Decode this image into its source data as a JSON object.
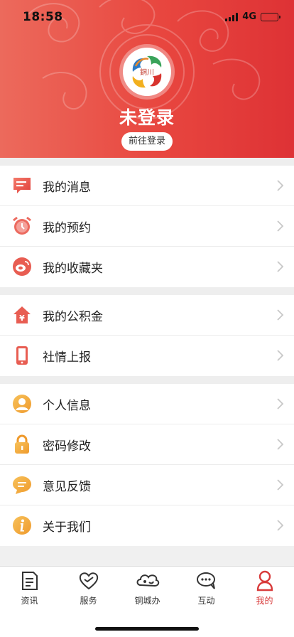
{
  "status_bar": {
    "time": "18:58",
    "network": "4G"
  },
  "profile": {
    "name": "未登录",
    "login_button": "前往登录",
    "logo_text": "銅川"
  },
  "menu_groups": [
    {
      "items": [
        {
          "label": "我的消息",
          "icon": "message-icon"
        },
        {
          "label": "我的预约",
          "icon": "alarm-clock-icon"
        },
        {
          "label": "我的收藏夹",
          "icon": "weibo-icon"
        }
      ]
    },
    {
      "items": [
        {
          "label": "我的公积金",
          "icon": "housing-fund-icon"
        },
        {
          "label": "社情上报",
          "icon": "phone-icon"
        }
      ]
    },
    {
      "items": [
        {
          "label": "个人信息",
          "icon": "user-icon"
        },
        {
          "label": "密码修改",
          "icon": "lock-icon"
        },
        {
          "label": "意见反馈",
          "icon": "feedback-icon"
        },
        {
          "label": "关于我们",
          "icon": "info-icon"
        }
      ]
    }
  ],
  "tabbar": {
    "items": [
      {
        "label": "资讯",
        "icon": "news-icon"
      },
      {
        "label": "服务",
        "icon": "heart-icon"
      },
      {
        "label": "铜城办",
        "icon": "cloud-icon"
      },
      {
        "label": "互动",
        "icon": "chat-icon"
      },
      {
        "label": "我的",
        "icon": "profile-icon",
        "active": true
      }
    ]
  },
  "colors": {
    "brand_red": "#e8463f",
    "active_tab": "#d83a3a"
  }
}
